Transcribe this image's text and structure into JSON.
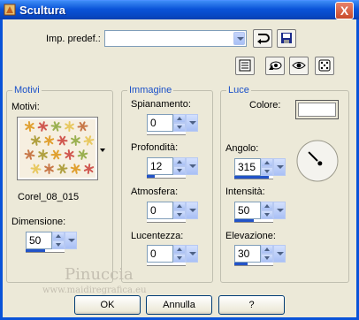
{
  "window": {
    "title": "Scultura",
    "close_symbol": "X"
  },
  "preset": {
    "label": "Imp. predef.:",
    "value": ""
  },
  "motivi": {
    "legend": "Motivi",
    "label": "Motivi:",
    "texture_name": "Corel_08_015",
    "dimensione_label": "Dimensione:",
    "dimensione_value": "50",
    "dimensione_fraction": 0.5
  },
  "immagine": {
    "legend": "Immagine",
    "spianamento_label": "Spianamento:",
    "spianamento_value": "0",
    "spianamento_fraction": 0,
    "profondita_label": "Profondità:",
    "profondita_value": "12",
    "profondita_fraction": 0.2,
    "atmosfera_label": "Atmosfera:",
    "atmosfera_value": "0",
    "atmosfera_fraction": 0,
    "lucentezza_label": "Lucentezza:",
    "lucentezza_value": "0",
    "lucentezza_fraction": 0
  },
  "luce": {
    "legend": "Luce",
    "colore_label": "Colore:",
    "colore_value": "#ffffff",
    "angolo_label": "Angolo:",
    "angolo_value": "315",
    "angolo_fraction": 0.875,
    "intensita_label": "Intensità:",
    "intensita_value": "50",
    "intensita_fraction": 0.5,
    "elevazione_label": "Elevazione:",
    "elevazione_value": "30",
    "elevazione_fraction": 0.33
  },
  "buttons": {
    "ok": "OK",
    "cancel": "Annulla",
    "help": "?"
  },
  "watermark": {
    "line1": "Pinuccia",
    "line2": "www.maidiregrafica.eu"
  }
}
